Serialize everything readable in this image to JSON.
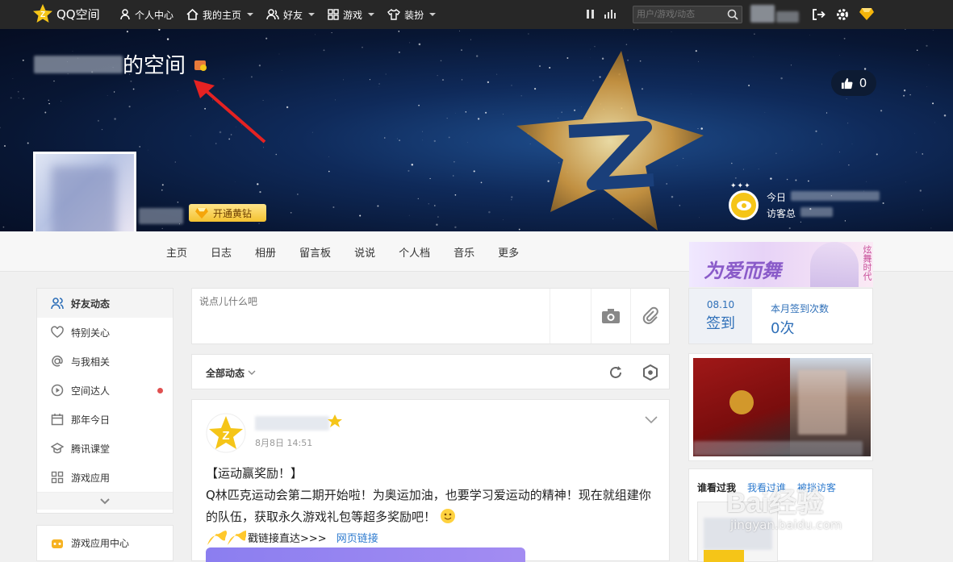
{
  "topbar": {
    "logo_text": "QQ空间",
    "nav": [
      {
        "label": "个人中心",
        "icon": "person-icon",
        "dropdown": false
      },
      {
        "label": "我的主页",
        "icon": "home-icon",
        "dropdown": true
      },
      {
        "label": "好友",
        "icon": "friends-icon",
        "dropdown": true
      },
      {
        "label": "游戏",
        "icon": "grid-icon",
        "dropdown": true
      },
      {
        "label": "装扮",
        "icon": "shirt-icon",
        "dropdown": true
      }
    ],
    "search_placeholder": "用户/游戏/动态"
  },
  "banner": {
    "title_suffix": "的空间",
    "likes": "0",
    "open_vip_label": "开通黄钻",
    "visitors_today": "今日",
    "visitors_total": "访客总"
  },
  "tabs": [
    "主页",
    "日志",
    "相册",
    "留言板",
    "说说",
    "个人档",
    "音乐",
    "更多"
  ],
  "ad": {
    "text": "为爱而舞",
    "side": "炫舞时代"
  },
  "sidebar": {
    "items": [
      {
        "label": "好友动态",
        "icon": "friends-feed-icon"
      },
      {
        "label": "特别关心",
        "icon": "heart-icon"
      },
      {
        "label": "与我相关",
        "icon": "at-icon"
      },
      {
        "label": "空间达人",
        "icon": "play-circle-icon"
      },
      {
        "label": "那年今日",
        "icon": "calendar-icon"
      },
      {
        "label": "腾讯课堂",
        "icon": "graduation-cap-icon"
      },
      {
        "label": "游戏应用",
        "icon": "apps-icon"
      }
    ],
    "game_center": "游戏应用中心"
  },
  "postbox": {
    "placeholder": "说点儿什么吧"
  },
  "filter": {
    "label": "全部动态"
  },
  "feed": {
    "date": "8月8日  14:51",
    "heading": "【运动赢奖励！】",
    "body": "Q林匹克运动会第二期开始啦！为奥运加油，也要学习爱运动的精神！现在就组建你的队伍，获取永久游戏礼包等超多奖励吧！",
    "link_prefix": "戳链接直达>>>",
    "link_text": "网页链接"
  },
  "checkin": {
    "date": "08.10",
    "button": "签到",
    "month_label": "本月签到次数",
    "month_count": "0次"
  },
  "whoseen": {
    "tabs": [
      "谁看过我",
      "我看过谁",
      "被挡访客"
    ]
  },
  "watermark": {
    "main": "Bai经验",
    "sub": "jingyan.baidu.com"
  },
  "colors": {
    "topbar": "#272727",
    "accent_link": "#2e7bcf",
    "vip": "#f4c230",
    "dot": "#e05050"
  }
}
